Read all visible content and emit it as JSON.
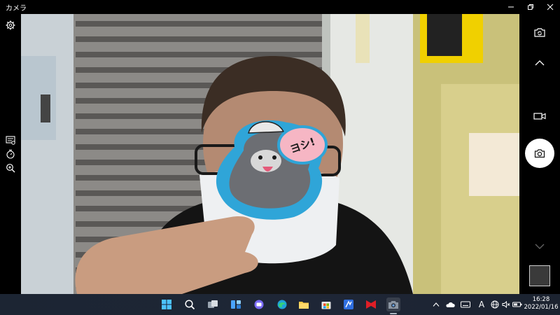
{
  "window": {
    "title": "カメラ"
  },
  "taskbar": {
    "time": "16:28",
    "date": "2022/01/16",
    "ime_label": "A"
  },
  "photo": {
    "badge_text": "ヨシ!"
  },
  "colors": {
    "accent": "#ffffff",
    "taskbar_bg": "#1e2636",
    "app_bg": "#000000"
  }
}
